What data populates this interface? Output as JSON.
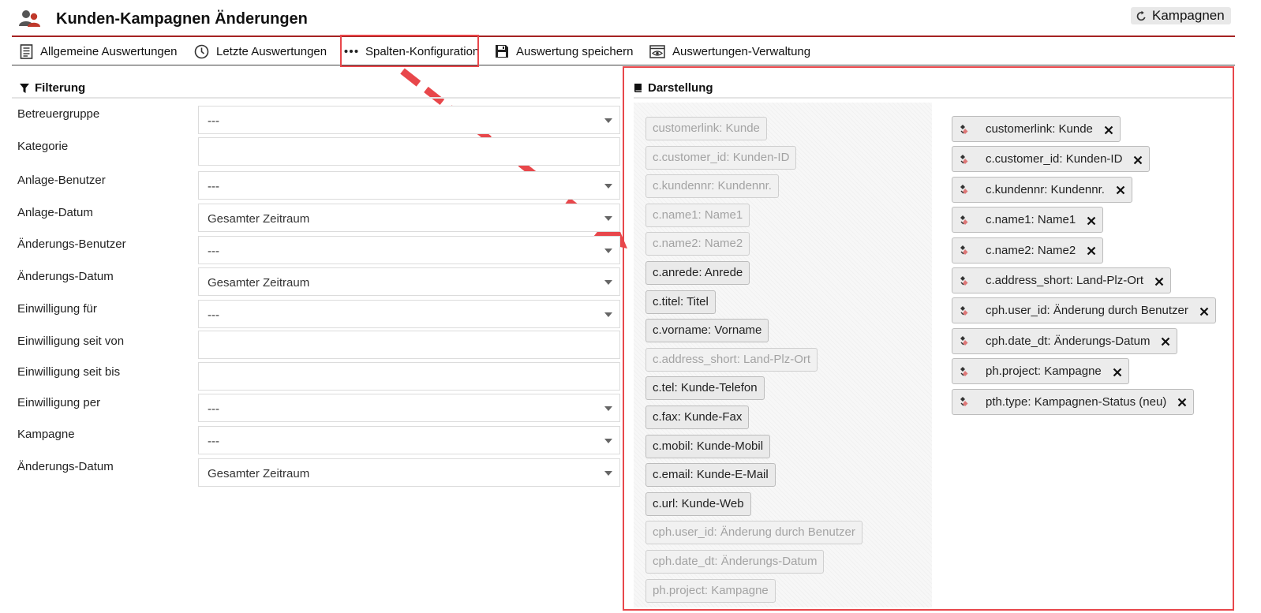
{
  "header": {
    "title": "Kunden-Kampagnen Änderungen",
    "back_label": "Kampagnen"
  },
  "toolbar": {
    "items": [
      {
        "label": "Allgemeine Auswertungen",
        "icon": "document-icon"
      },
      {
        "label": "Letzte Auswertungen",
        "icon": "clock-icon"
      },
      {
        "label": "Spalten-Konfiguration",
        "icon": "ellipsis-icon"
      },
      {
        "label": "Auswertung speichern",
        "icon": "floppy-icon"
      },
      {
        "label": "Auswertungen-Verwaltung",
        "icon": "eye-window-icon"
      }
    ]
  },
  "filter": {
    "title": "Filterung",
    "fields": [
      {
        "label": "Betreuergruppe",
        "value": "---",
        "type": "select"
      },
      {
        "label": "Kategorie",
        "value": "",
        "type": "text"
      },
      {
        "label": "Anlage-Benutzer",
        "value": "---",
        "type": "select"
      },
      {
        "label": "Anlage-Datum",
        "value": "Gesamter Zeitraum",
        "type": "select"
      },
      {
        "label": "Änderungs-Benutzer",
        "value": "---",
        "type": "select"
      },
      {
        "label": "Änderungs-Datum",
        "value": "Gesamter Zeitraum",
        "type": "select"
      },
      {
        "label": "Einwilligung für",
        "value": "---",
        "type": "select"
      },
      {
        "label": "Einwilligung seit von",
        "value": "",
        "type": "text"
      },
      {
        "label": "Einwilligung seit bis",
        "value": "",
        "type": "text"
      },
      {
        "label": "Einwilligung per",
        "value": "---",
        "type": "select"
      },
      {
        "label": "Kampagne",
        "value": "---",
        "type": "select"
      },
      {
        "label": "Änderungs-Datum",
        "value": "Gesamter Zeitraum",
        "type": "select"
      }
    ]
  },
  "display": {
    "title": "Darstellung",
    "available": [
      {
        "label": "customerlink: Kunde",
        "state": "dim"
      },
      {
        "label": "c.customer_id: Kunden-ID",
        "state": "dim"
      },
      {
        "label": "c.kundennr: Kundennr.",
        "state": "dim"
      },
      {
        "label": "c.name1: Name1",
        "state": "dim"
      },
      {
        "label": "c.name2: Name2",
        "state": "dim"
      },
      {
        "label": "c.anrede: Anrede",
        "state": "active"
      },
      {
        "label": "c.titel: Titel",
        "state": "active"
      },
      {
        "label": "c.vorname: Vorname",
        "state": "active"
      },
      {
        "label": "c.address_short: Land-Plz-Ort",
        "state": "dim"
      },
      {
        "label": "c.tel: Kunde-Telefon",
        "state": "active"
      },
      {
        "label": "c.fax: Kunde-Fax",
        "state": "active"
      },
      {
        "label": "c.mobil: Kunde-Mobil",
        "state": "active"
      },
      {
        "label": "c.email: Kunde-E-Mail",
        "state": "active"
      },
      {
        "label": "c.url: Kunde-Web",
        "state": "active"
      },
      {
        "label": "cph.user_id: Änderung durch Benutzer",
        "state": "dim"
      },
      {
        "label": "cph.date_dt: Änderungs-Datum",
        "state": "dim"
      },
      {
        "label": "ph.project: Kampagne",
        "state": "dim"
      }
    ],
    "selected": [
      {
        "label": "customerlink: Kunde"
      },
      {
        "label": "c.customer_id: Kunden-ID"
      },
      {
        "label": "c.kundennr: Kundennr."
      },
      {
        "label": "c.name1: Name1"
      },
      {
        "label": "c.name2: Name2"
      },
      {
        "label": "c.address_short: Land-Plz-Ort"
      },
      {
        "label": "cph.user_id: Änderung durch Benutzer"
      },
      {
        "label": "cph.date_dt: Änderungs-Datum"
      },
      {
        "label": "ph.project: Kampagne"
      },
      {
        "label": "pth.type: Kampagnen-Status (neu)"
      }
    ]
  },
  "colors": {
    "accent": "#a52222",
    "callout": "#e8474b"
  }
}
